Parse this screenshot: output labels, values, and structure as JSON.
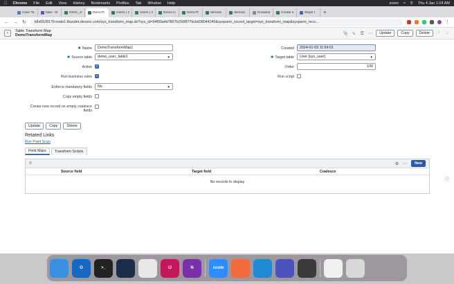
{
  "menubar": {
    "items": [
      "Chrome",
      "File",
      "Edit",
      "View",
      "History",
      "Bookmarks",
      "Profiles",
      "Tab",
      "Window",
      "Help"
    ],
    "zoom_label": "zoom",
    "clock": "Thu 4 Jan  1:24 AM"
  },
  "tabs": [
    {
      "label": "Case Ta",
      "color": "#4a7fc1"
    },
    {
      "label": "bala - M",
      "color": "#6a4fb3"
    },
    {
      "label": "OIGC_JA",
      "color": "#2f7d5a"
    },
    {
      "label": "DemoTr",
      "color": "#2f7d5a",
      "active": true
    },
    {
      "label": "Users | S",
      "color": "#2f7d5a"
    },
    {
      "label": "Users | S",
      "color": "#2f7d5a"
    },
    {
      "label": "Demo U",
      "color": "#2f7d5a"
    },
    {
      "label": "DemoTr",
      "color": "#2f7d5a"
    },
    {
      "label": "demodi",
      "color": "#2f7d5a"
    },
    {
      "label": "demodi",
      "color": "#2f7d5a"
    },
    {
      "label": "Knowled",
      "color": "#888888"
    },
    {
      "label": "Create a",
      "color": "#2f7d5a"
    },
    {
      "label": "Steps t",
      "color": "#3b6db3"
    }
  ],
  "address": {
    "url": "k8s0528179-node1.thunder.devsnc.com/sys_transform_map.do?sys_id=94f00a4d7867b150f877bcbd28044245&sysparm_record_target=sys_transform_map&sysparm_reco..."
  },
  "header": {
    "title": "Table Transform Map",
    "subtitle": "DemoTransformMap",
    "update_label": "Update",
    "copy_label": "Copy",
    "delete_label": "Delete"
  },
  "form": {
    "name_label": "Name",
    "name_value": "DemoTransformMap1",
    "source_table_label": "Source table",
    "source_table_value": "demo_user_table1",
    "active_label": "Active",
    "run_business_rules_label": "Run business rules",
    "enforce_mandatory_label": "Enforce mandatory fields",
    "enforce_mandatory_value": "No",
    "copy_empty_label": "Copy empty fields",
    "create_new_label_1": "Create new record on empty coalesce",
    "create_new_label_2": "fields",
    "created_label": "Created",
    "created_value": "2024-01-03 11:54:01",
    "target_table_label": "Target table",
    "target_table_value": "User [sys_user]",
    "order_label": "Order",
    "order_value": "100",
    "run_script_label": "Run script"
  },
  "bottom_buttons": {
    "update": "Update",
    "copy": "Copy",
    "delete": "Delete"
  },
  "related": {
    "title": "Related Links",
    "run_point_scan": "Run Point Scan",
    "tabs": [
      "Field Maps",
      "Transform Scripts"
    ],
    "new_label": "New",
    "columns": [
      "Source field",
      "Target field",
      "Coalesce"
    ],
    "empty_text": "No records to display"
  },
  "dock": {
    "apps": [
      {
        "name": "Finder",
        "color": "#3a8fe0",
        "text": ""
      },
      {
        "name": "Outlook",
        "color": "#1668c1",
        "text": "O"
      },
      {
        "name": "Terminal",
        "color": "#222222",
        "text": ">_"
      },
      {
        "name": "Proton",
        "color": "#1c2d4a",
        "text": ""
      },
      {
        "name": "Chrome",
        "color": "#e8e8e8",
        "text": ""
      },
      {
        "name": "IntelliJ",
        "color": "#c2185b",
        "text": "IJ"
      },
      {
        "name": "OneNote",
        "color": "#7b2fa8",
        "text": "N"
      },
      {
        "name": "Zoom",
        "color": "#2d8cff",
        "text": "zoom"
      },
      {
        "name": "Postman",
        "color": "#f26b3a",
        "text": ""
      },
      {
        "name": "VS Code",
        "color": "#1f8ad2",
        "text": ""
      },
      {
        "name": "Teams",
        "color": "#4b53bc",
        "text": ""
      },
      {
        "name": "QuickTime",
        "color": "#3a3a3a",
        "text": ""
      },
      {
        "name": "Preview",
        "color": "#f0f0f0",
        "text": ""
      },
      {
        "name": "Trash",
        "color": "#d8d8d8",
        "text": ""
      }
    ]
  }
}
